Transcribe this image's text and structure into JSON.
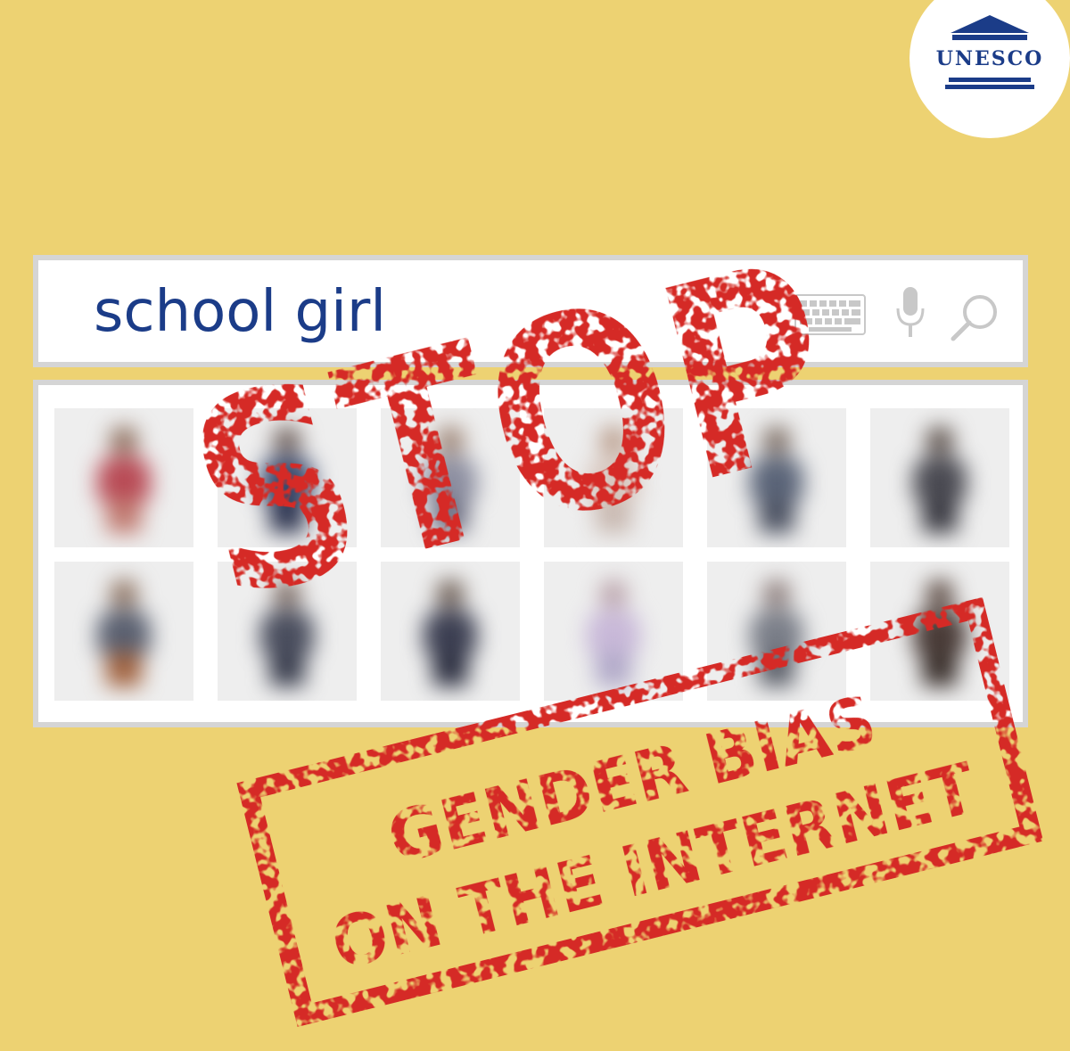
{
  "brand": {
    "logo_text": "UNESCO"
  },
  "search": {
    "query": "school girl"
  },
  "stamp": {
    "big_word": "STOP",
    "line1": "GENDER BIAS",
    "line2": "ON THE INTERNET"
  },
  "colors": {
    "background": "#EDD272",
    "stamp_red": "#D52B25",
    "unesco_blue": "#1B3C88",
    "border_gray": "#D5D5D5"
  },
  "icons": [
    "keyboard-icon",
    "microphone-icon",
    "search-icon",
    "unesco-temple-logo"
  ]
}
